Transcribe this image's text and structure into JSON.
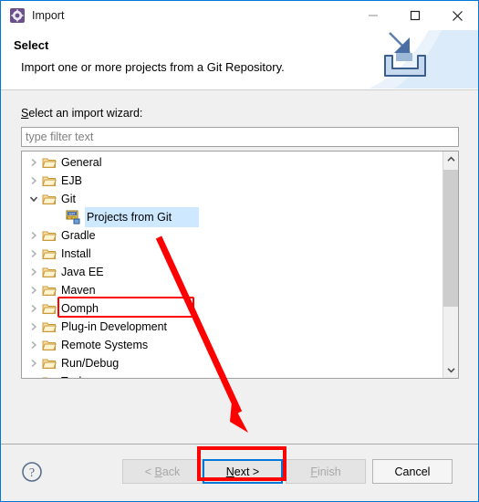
{
  "window": {
    "title": "Import",
    "icon": "eclipse-import-icon",
    "controls": {
      "minimize": "minimize-icon",
      "maximize": "maximize-icon",
      "close": "close-icon"
    }
  },
  "header": {
    "title": "Select",
    "description": "Import one or more projects from a Git Repository.",
    "banner_icon": "import-tray-arrow-icon"
  },
  "main": {
    "wizard_label_prefix": "S",
    "wizard_label_rest": "elect an import wizard:",
    "filter": {
      "value": "",
      "placeholder": "type filter text"
    },
    "tree": [
      {
        "label": "General",
        "level": 0,
        "expanded": false,
        "icon": "folder-icon",
        "selected": false
      },
      {
        "label": "EJB",
        "level": 0,
        "expanded": false,
        "icon": "folder-icon",
        "selected": false
      },
      {
        "label": "Git",
        "level": 0,
        "expanded": true,
        "icon": "folder-icon",
        "selected": false
      },
      {
        "label": "Projects from Git",
        "level": 1,
        "expanded": null,
        "icon": "git-icon",
        "selected": true
      },
      {
        "label": "Gradle",
        "level": 0,
        "expanded": false,
        "icon": "folder-icon",
        "selected": false
      },
      {
        "label": "Install",
        "level": 0,
        "expanded": false,
        "icon": "folder-icon",
        "selected": false
      },
      {
        "label": "Java EE",
        "level": 0,
        "expanded": false,
        "icon": "folder-icon",
        "selected": false
      },
      {
        "label": "Maven",
        "level": 0,
        "expanded": false,
        "icon": "folder-icon",
        "selected": false
      },
      {
        "label": "Oomph",
        "level": 0,
        "expanded": false,
        "icon": "folder-icon",
        "selected": false
      },
      {
        "label": "Plug-in Development",
        "level": 0,
        "expanded": false,
        "icon": "folder-icon",
        "selected": false
      },
      {
        "label": "Remote Systems",
        "level": 0,
        "expanded": false,
        "icon": "folder-icon",
        "selected": false
      },
      {
        "label": "Run/Debug",
        "level": 0,
        "expanded": false,
        "icon": "folder-icon",
        "selected": false
      },
      {
        "label": "Tasks",
        "level": 0,
        "expanded": false,
        "icon": "folder-icon",
        "selected": false
      }
    ],
    "scrollbar": {
      "up_arrow": "chevron-up-icon",
      "down_arrow": "chevron-down-icon"
    }
  },
  "footer": {
    "help_icon": "help-question-icon",
    "back": {
      "label_prefix": "< ",
      "label_key": "B",
      "label_rest": "ack",
      "enabled": false
    },
    "next": {
      "label_key": "N",
      "label_rest": "ext >",
      "enabled": true,
      "focused": true
    },
    "finish": {
      "label_key": "F",
      "label_rest": "inish",
      "enabled": false
    },
    "cancel": {
      "label": "Cancel",
      "enabled": true
    }
  },
  "annotations": {
    "highlight_color": "#ff0000",
    "selected_item_box": "Projects from Git",
    "next_button_box": "Next >",
    "arrow": "red-arrow-pointing-to-next-button"
  },
  "colors": {
    "window_border": "#0078d7",
    "focus_border": "#0078d7",
    "selection": "#cde8ff",
    "annotation": "#ff0000"
  }
}
